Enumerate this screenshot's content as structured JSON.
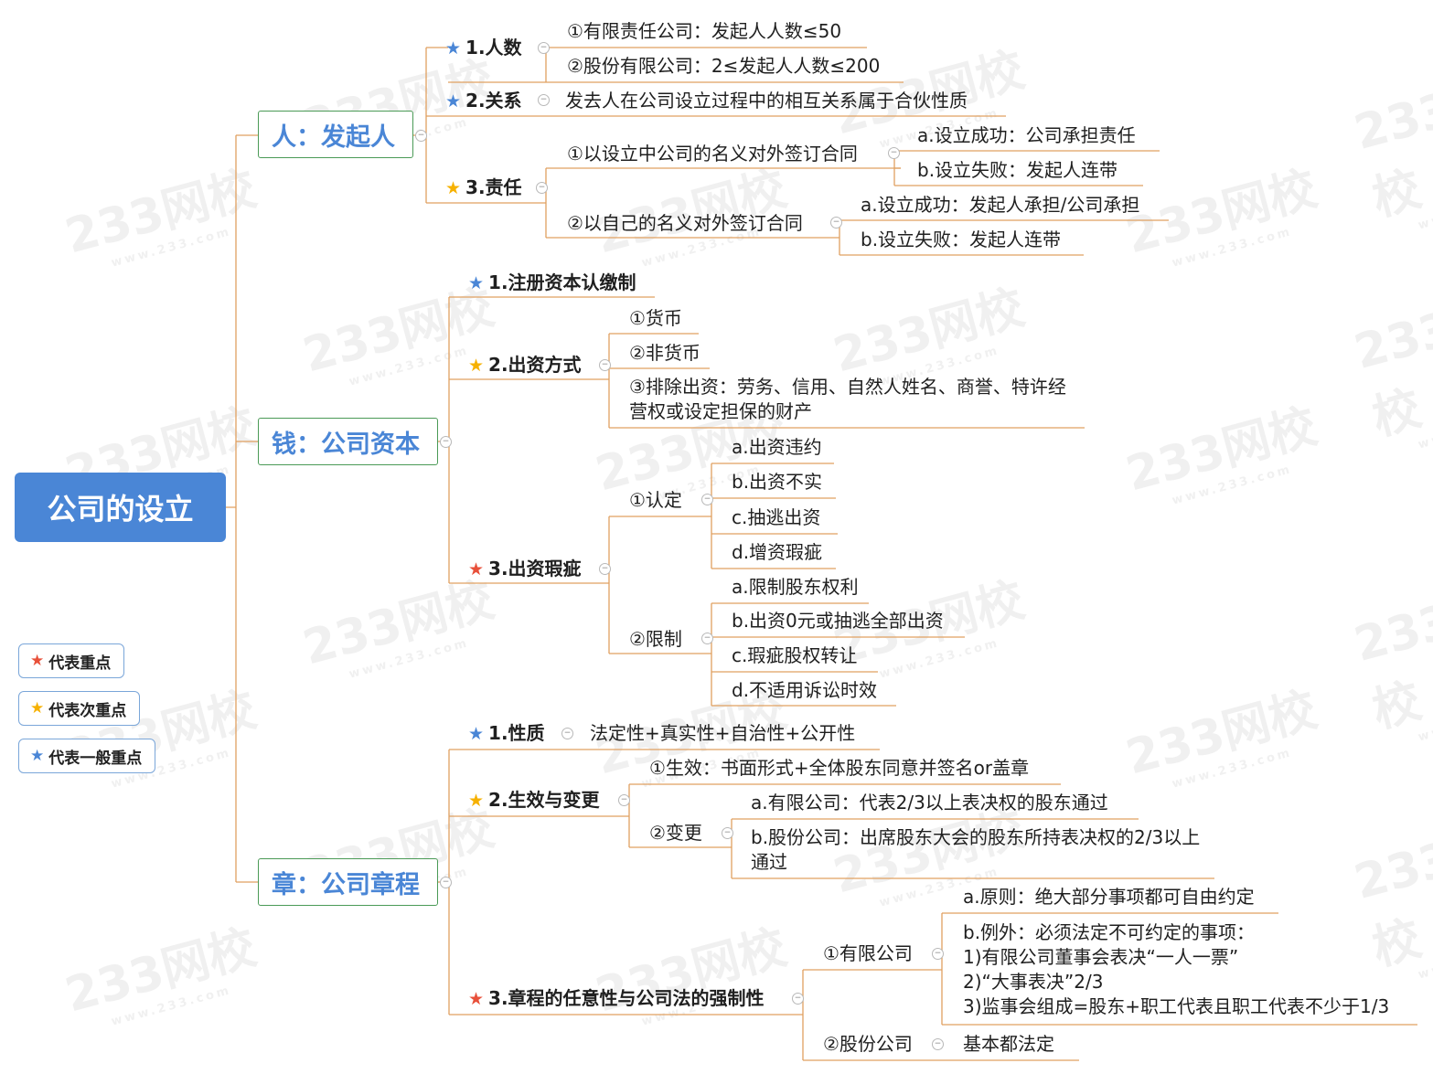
{
  "colors": {
    "root_bg": "#4a86d6",
    "main_border": "#4a9a56",
    "main_text": "#4a86d6",
    "line": "#e0a060",
    "star_red": "#e8503a",
    "star_yellow": "#f6b100",
    "star_blue": "#4a86d6"
  },
  "root": "公司的设立",
  "main": [
    "人：发起人",
    "钱：公司资本",
    "章：公司章程"
  ],
  "people": {
    "count": {
      "label": "1.人数",
      "star": "blue",
      "items": [
        "①有限责任公司：发起人人数≤50",
        "②股份有限公司：2≤发起人人数≤200"
      ]
    },
    "relation": {
      "label": "2.关系",
      "star": "blue",
      "desc": "发去人在公司设立过程中的相互关系属于合伙性质"
    },
    "liability": {
      "label": "3.责任",
      "star": "yellow",
      "a": {
        "label": "①以设立中公司的名义对外签订合同",
        "items": [
          "a.设立成功：公司承担责任",
          "b.设立失败：发起人连带"
        ]
      },
      "b": {
        "label": "②以自己的名义对外签订合同",
        "items": [
          "a.设立成功：发起人承担/公司承担",
          "b.设立失败：发起人连带"
        ]
      }
    }
  },
  "capital": {
    "subscription": {
      "label": "1.注册资本认缴制",
      "star": "blue"
    },
    "methods": {
      "label": "2.出资方式",
      "star": "yellow",
      "items": [
        "①货币",
        "②非货币",
        "③排除出资：劳务、信用、自然人姓名、商誉、特许经营权或设定担保的财产"
      ]
    },
    "defects": {
      "label": "3.出资瑕疵",
      "star": "red",
      "identify": {
        "label": "①认定",
        "items": [
          "a.出资违约",
          "b.出资不实",
          "c.抽逃出资",
          "d.增资瑕疵"
        ]
      },
      "restrict": {
        "label": "②限制",
        "items": [
          "a.限制股东权利",
          "b.出资0元或抽逃全部出资",
          "c.瑕疵股权转让",
          "d.不适用诉讼时效"
        ]
      }
    }
  },
  "charter": {
    "nature": {
      "label": "1.性质",
      "star": "blue",
      "desc": "法定性+真实性+自治性+公开性"
    },
    "effect": {
      "label": "2.生效与变更",
      "star": "yellow",
      "effective": "①生效：书面形式+全体股东同意并签名or盖章",
      "change": {
        "label": "②变更",
        "items": [
          "a.有限公司：代表2/3以上表决权的股东通过",
          "b.股份公司：出席股东大会的股东所持表决权的2/3以上通过"
        ]
      }
    },
    "mandatory": {
      "label": "3.章程的任意性与公司法的强制性",
      "star": "red",
      "llc": {
        "label": "①有限公司",
        "principle": "a.原则：绝大部分事项都可自由约定",
        "exception": [
          "b.例外：必须法定不可约定的事项：",
          "1)有限公司董事会表决“一人一票”",
          "2)“大事表决”2/3",
          "3)监事会组成=股东+职工代表且职工代表不少于1/3"
        ]
      },
      "joint": {
        "label": "②股份公司",
        "desc": "基本都法定"
      }
    }
  },
  "legend": [
    {
      "star": "red",
      "label": "代表重点"
    },
    {
      "star": "yellow",
      "label": "代表次重点"
    },
    {
      "star": "blue",
      "label": "代表一般重点"
    }
  ],
  "watermark": {
    "brand": "233网校",
    "site": "www.233.com"
  }
}
